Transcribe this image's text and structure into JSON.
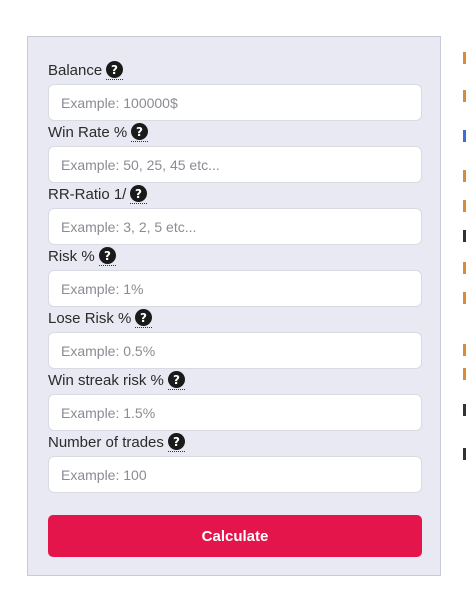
{
  "form": {
    "fields": [
      {
        "label": "Balance",
        "placeholder": "Example: 100000$"
      },
      {
        "label": "Win Rate %",
        "placeholder": "Example: 50, 25, 45 etc..."
      },
      {
        "label": "RR-Ratio 1/",
        "placeholder": "Example: 3, 2, 5 etc..."
      },
      {
        "label": "Risk %",
        "placeholder": "Example: 1%"
      },
      {
        "label": "Lose Risk %",
        "placeholder": "Example: 0.5%"
      },
      {
        "label": "Win streak risk %",
        "placeholder": "Example: 1.5%"
      },
      {
        "label": "Number of trades",
        "placeholder": "Example: 100"
      }
    ],
    "submit_label": "Calculate"
  },
  "colors": {
    "panel_bg": "#e8e9f2",
    "button_bg": "#e3154b",
    "button_text": "#ffffff",
    "help_icon": "#1a1a1a",
    "edge_accent": "#d98a3a",
    "edge_dark": "#333333",
    "edge_link": "#3b6fd6"
  },
  "icons": {
    "help": "question-circle-icon"
  }
}
